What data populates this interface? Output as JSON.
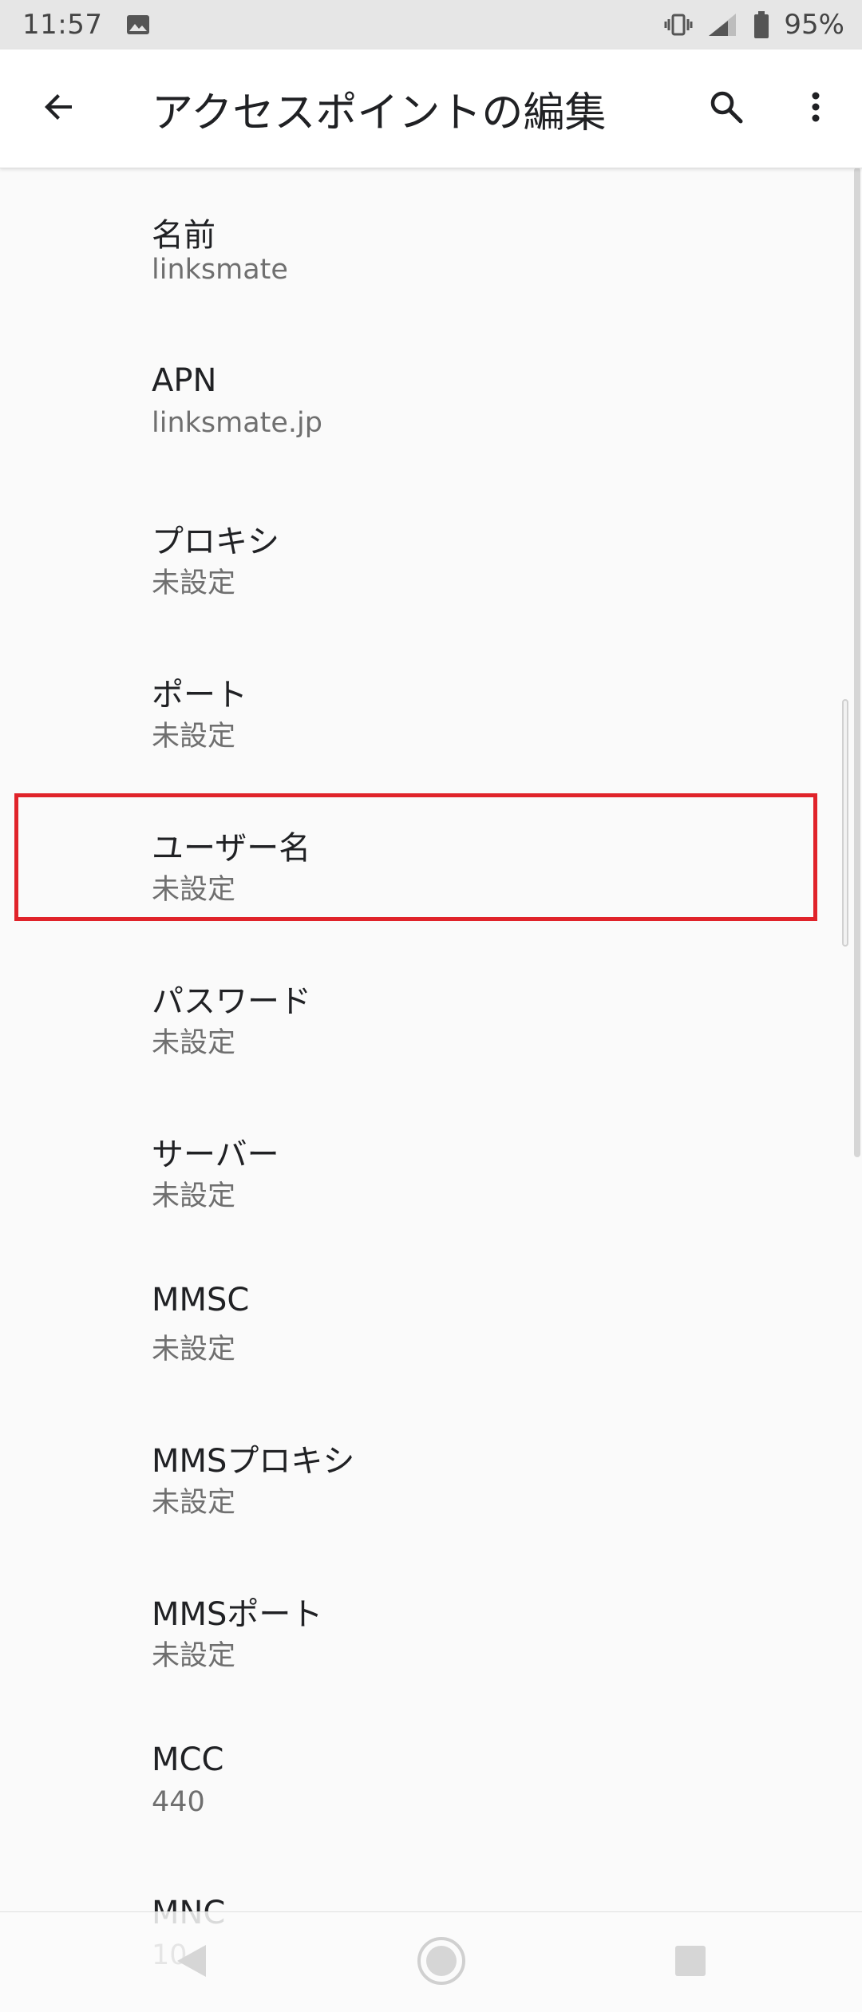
{
  "status_bar": {
    "time": "11:57",
    "battery": "95%",
    "icons": [
      "image-icon",
      "vibrate-icon",
      "signal-icon",
      "battery-icon"
    ]
  },
  "app_bar": {
    "title": "アクセスポイントの編集",
    "icons": [
      "back-arrow-icon",
      "search-icon",
      "more-vert-icon"
    ]
  },
  "settings": [
    {
      "title": "名前",
      "summary": "linksmate"
    },
    {
      "title": "APN",
      "summary": "linksmate.jp"
    },
    {
      "title": "プロキシ",
      "summary": "未設定"
    },
    {
      "title": "ポート",
      "summary": "未設定"
    },
    {
      "title": "ユーザー名",
      "summary": "未設定"
    },
    {
      "title": "パスワード",
      "summary": "未設定"
    },
    {
      "title": "サーバー",
      "summary": "未設定"
    },
    {
      "title": "MMSC",
      "summary": "未設定"
    },
    {
      "title": "MMSプロキシ",
      "summary": "未設定"
    },
    {
      "title": "MMSポート",
      "summary": "未設定"
    },
    {
      "title": "MCC",
      "summary": "440"
    },
    {
      "title": "MNC",
      "summary": "10"
    }
  ],
  "highlight": {
    "target": "ユーザー名",
    "color": "#e0232a"
  },
  "nav_bar": {
    "icons": [
      "nav-back-icon",
      "nav-home-icon",
      "nav-recents-icon"
    ]
  }
}
